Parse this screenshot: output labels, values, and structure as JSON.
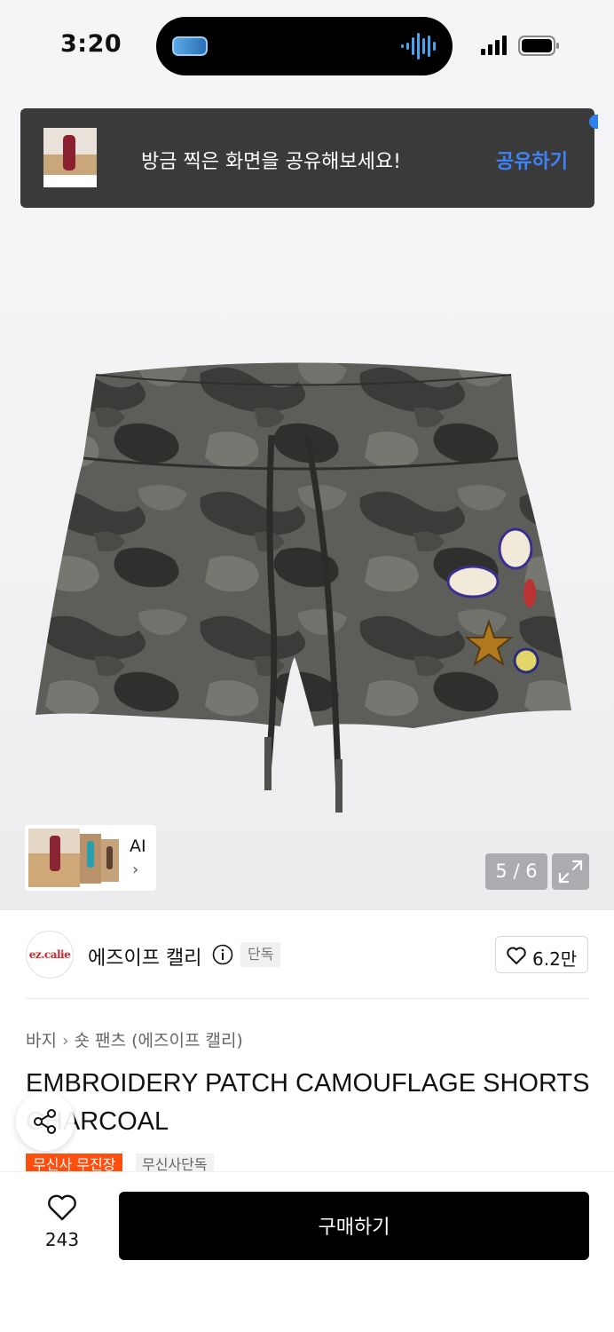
{
  "status_bar": {
    "time": "3:20"
  },
  "toast": {
    "message": "방금 찍은 화면을 공유해보세요!",
    "action": "공유하기"
  },
  "gallery": {
    "ai_label": "AI",
    "counter": "5 / 6"
  },
  "brand": {
    "name": "에즈이프 캘리",
    "logo_text": "ez.calie",
    "badge": "단독",
    "likes": "6.2만"
  },
  "breadcrumb": {
    "category": "바지",
    "subcategory": "숏 팬츠 (에즈이프 캘리)"
  },
  "product": {
    "title": "EMBROIDERY PATCH CAMOUFLAGE SHORTS CHARCOAL",
    "tags": [
      "무신사 무진장",
      "무신사단독"
    ]
  },
  "bottom_bar": {
    "like_count": "243",
    "buy_label": "구매하기"
  },
  "colors": {
    "accent_blue": "#3f83f8",
    "tag_orange": "#ff4f0e",
    "buy_button": "#000000"
  }
}
